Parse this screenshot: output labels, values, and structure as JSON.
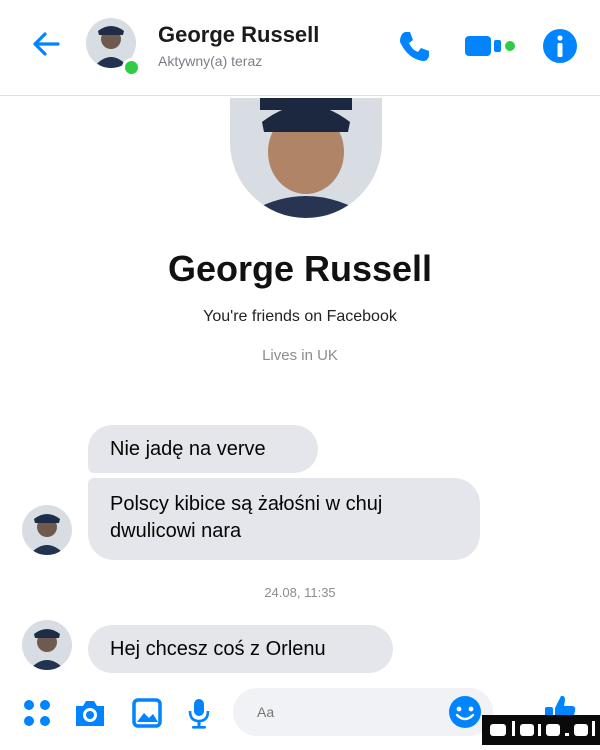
{
  "header": {
    "name": "George Russell",
    "status": "Aktywny(a) teraz"
  },
  "profile": {
    "name": "George Russell",
    "friends_text": "You're friends on Facebook",
    "lives_text": "Lives in UK"
  },
  "messages": [
    {
      "text": "Nie jadę na verve"
    },
    {
      "text": "Polscy kibice są żałośni w chuj dwulicowi nara"
    },
    {
      "text": "Hej chcesz coś z Orlenu"
    }
  ],
  "timestamp": "24.08, 11:35",
  "composer": {
    "placeholder": "Aa"
  },
  "colors": {
    "accent": "#0084ff",
    "bubble": "#e4e6eb",
    "online": "#31cc46"
  }
}
